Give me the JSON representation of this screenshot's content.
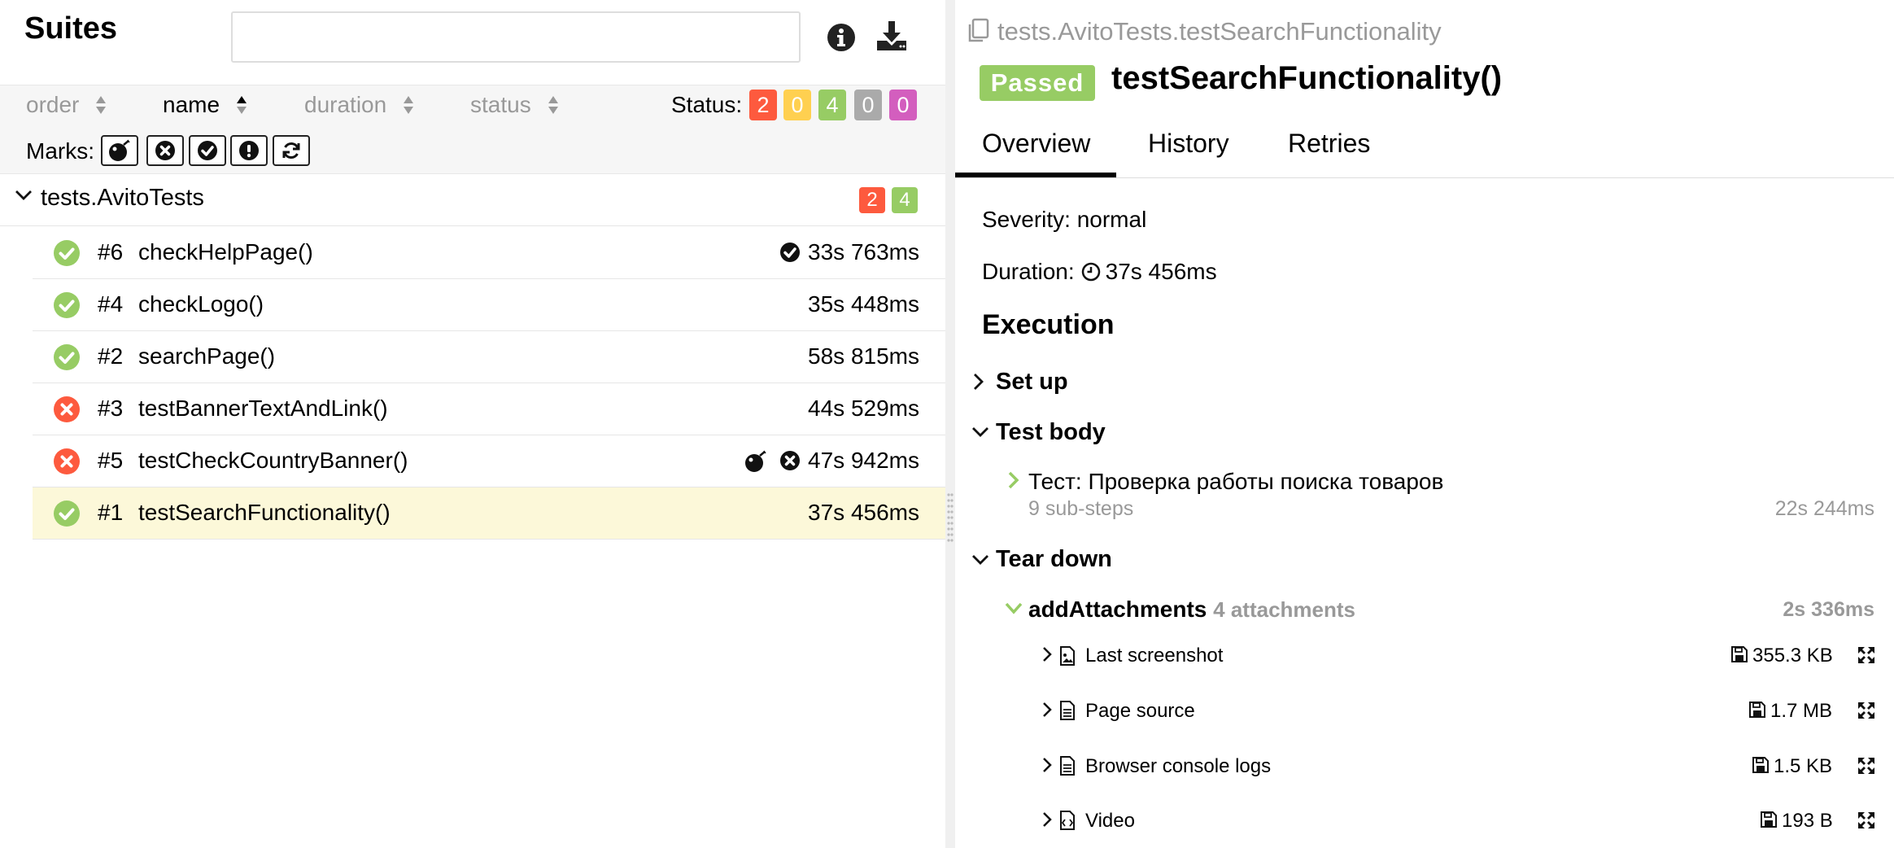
{
  "left": {
    "title": "Suites",
    "search": {
      "value": "",
      "placeholder": ""
    },
    "sort": {
      "order": "order",
      "name": "name",
      "duration": "duration",
      "status": "status"
    },
    "status_label": "Status:",
    "status_counts": [
      {
        "value": "2",
        "color": "#fd5a3e"
      },
      {
        "value": "0",
        "color": "#ffd050"
      },
      {
        "value": "4",
        "color": "#97cc64"
      },
      {
        "value": "0",
        "color": "#aaaaaa"
      },
      {
        "value": "0",
        "color": "#d35ebe"
      }
    ],
    "marks_label": "Marks:",
    "marks": [
      "flaky-icon",
      "failed-icon",
      "passed-icon",
      "broken-icon",
      "retries-icon"
    ],
    "group": {
      "name": "tests.AvitoTests",
      "failed": "2",
      "passed": "4"
    },
    "tests": [
      {
        "status": "passed",
        "num": "#6",
        "name": "checkHelpPage()",
        "duration": "33s 763ms",
        "marks": [
          "passed"
        ]
      },
      {
        "status": "passed",
        "num": "#4",
        "name": "checkLogo()",
        "duration": "35s 448ms",
        "marks": []
      },
      {
        "status": "passed",
        "num": "#2",
        "name": "searchPage()",
        "duration": "58s 815ms",
        "marks": []
      },
      {
        "status": "failed",
        "num": "#3",
        "name": "testBannerTextAndLink()",
        "duration": "44s 529ms",
        "marks": []
      },
      {
        "status": "failed",
        "num": "#5",
        "name": "testCheckCountryBanner()",
        "duration": "47s 942ms",
        "marks": [
          "flaky",
          "failed"
        ]
      },
      {
        "status": "passed",
        "num": "#1",
        "name": "testSearchFunctionality()",
        "duration": "37s 456ms",
        "marks": [],
        "selected": true
      }
    ]
  },
  "right": {
    "breadcrumb": "tests.AvitoTests.testSearchFunctionality",
    "status_badge": "Passed",
    "title": "testSearchFunctionality()",
    "tabs": [
      "Overview",
      "History",
      "Retries"
    ],
    "severity": "Severity: normal",
    "duration_label": "Duration:",
    "duration_value": "37s 456ms",
    "execution_title": "Execution",
    "setup_title": "Set up",
    "body_title": "Test body",
    "step": {
      "title": "Тест: Проверка работы поиска товаров",
      "substeps": "9 sub-steps",
      "duration": "22s 244ms"
    },
    "teardown_title": "Tear down",
    "teardown_step": {
      "name": "addAttachments",
      "count": "4 attachments",
      "duration": "2s 336ms"
    },
    "attachments": [
      {
        "icon": "image-icon",
        "name": "Last screenshot",
        "size": "355.3 KB"
      },
      {
        "icon": "file-text-icon",
        "name": "Page source",
        "size": "1.7 MB"
      },
      {
        "icon": "file-text-icon",
        "name": "Browser console logs",
        "size": "1.5 KB"
      },
      {
        "icon": "file-code-icon",
        "name": "Video",
        "size": "193 B"
      }
    ]
  }
}
